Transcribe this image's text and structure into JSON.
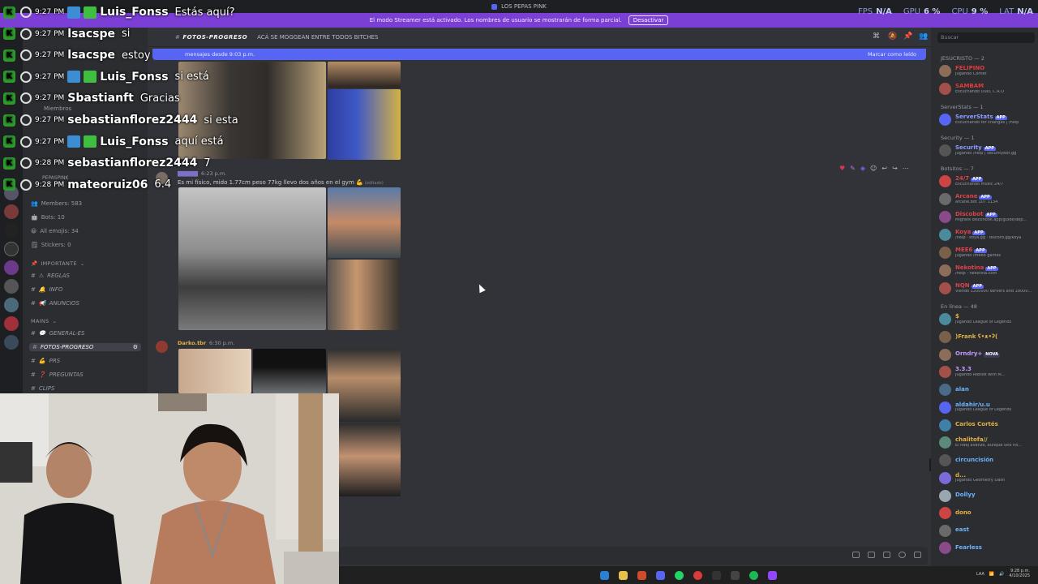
{
  "window": {
    "title": "LOS PEPAS PINK"
  },
  "perf": [
    {
      "label": "FPS",
      "value": "N/A"
    },
    {
      "label": "GPU",
      "value": "6 %"
    },
    {
      "label": "CPU",
      "value": "9 %"
    },
    {
      "label": "LAT",
      "value": "N/A"
    }
  ],
  "streamer_banner": {
    "text": "El modo Streamer está activado. Los nombres de usuario se mostrarán de forma parcial.",
    "button": "Desactivar"
  },
  "sidebar": {
    "members_label": "Miembros",
    "server_name": "PEPASPINK",
    "stats": [
      {
        "icon": "people-icon",
        "text": "Members: 583"
      },
      {
        "icon": "robot-icon",
        "text": "Bots: 10"
      },
      {
        "icon": "emoji-icon",
        "text": "All emojis: 34"
      },
      {
        "icon": "sticker-icon",
        "text": "Stickers: 0"
      }
    ],
    "categories": [
      {
        "name": "IMPORTANTE",
        "channels": [
          "REGLAS",
          "INFO",
          "ANUNCIOS"
        ]
      },
      {
        "name": "MAINS",
        "channels": [
          "GENERAL-ES",
          "FOTOS-PROGRESO",
          "PRS",
          "PREGUNTAS",
          "CLIPS"
        ]
      }
    ],
    "active_channel": "FOTOS-PROGRESO"
  },
  "channel_header": {
    "name": "FOTOS-PROGRESO",
    "topic": "ACÁ SE MOGGEAN ENTRE TODOS BITCHES"
  },
  "new_messages_bar": {
    "left": "mensajes desde 9:03 p.m.",
    "right": "Marcar como leído"
  },
  "messages": [
    {
      "time": "6:23 p.m.",
      "text": "Es mi físico, mido 1.77cm peso 77kg llevo dos años en el gym",
      "edited": "(editado)"
    },
    {
      "author": "Darko.tbr",
      "time": "6:30 p.m."
    }
  ],
  "members_panel": {
    "search_placeholder": "Buscar",
    "groups": [
      {
        "title": "JESUCRISTO — 2",
        "members": [
          {
            "name": "FELIPINO",
            "status": "Jugando Cornet",
            "color": "#e03b3b"
          },
          {
            "name": "SAMBAM",
            "status": "Escuchando Duki, C.R.O",
            "color": "#e03b3b"
          }
        ]
      },
      {
        "title": "ServerStats — 1",
        "members": [
          {
            "name": "ServerStats",
            "app": "APP",
            "status": "Escuchando for changes | /help",
            "color": "#8a9bff"
          }
        ]
      },
      {
        "title": "Security — 1",
        "members": [
          {
            "name": "Security",
            "app": "APP",
            "status": "Jugando /help | securitybot.gg",
            "color": "#8a9bff"
          }
        ]
      },
      {
        "title": "Botsitos — 7",
        "members": [
          {
            "name": "24/7",
            "app": "APP",
            "status": "Escuchando music 24/7",
            "color": "#d9434a"
          },
          {
            "name": "Arcane",
            "app": "APP",
            "status": "arcane.bot 107 1134",
            "color": "#d9434a"
          },
          {
            "name": "Discobot",
            "app": "APP",
            "status": "Migrate discohook.app/guide/dep...",
            "color": "#d9434a"
          },
          {
            "name": "Koya",
            "app": "APP",
            "status": "/help · koya.gg · discord.gg/koya",
            "color": "#d9434a"
          },
          {
            "name": "MEE6",
            "app": "APP",
            "status": "Jugando /mee6 games",
            "color": "#d9434a"
          },
          {
            "name": "Nekotina",
            "app": "APP",
            "status": "/help - nekotina.com",
            "color": "#d9434a"
          },
          {
            "name": "NQN",
            "app": "APP",
            "status": "Viendo 1200000 servers and 18000...",
            "color": "#d9434a"
          }
        ]
      },
      {
        "title": "En línea — 48",
        "members": [
          {
            "name": "$",
            "status": "Jugando League of Legends",
            "color": "#e3b341"
          },
          {
            "name": ")Frank ʕ•ᴥ•ʔ(",
            "status": "",
            "color": "#e3b341"
          },
          {
            "name": "Orndry+",
            "nova": "NOVA",
            "status": "",
            "color": "#c597ff"
          },
          {
            "name": "3.3.3",
            "status": "Jugando Roblox with M...",
            "color": "#c597ff"
          },
          {
            "name": "alan",
            "status": "",
            "color": "#6ab4ff"
          },
          {
            "name": "aldahir/u.u",
            "status": "Jugando League of Legends",
            "color": "#6ab4ff"
          },
          {
            "name": "Carlos Cortés",
            "status": "",
            "color": "#e3b341"
          },
          {
            "name": "chalitofa//",
            "status": "El ndej avanza, aunque uno no...",
            "color": "#e3b341"
          },
          {
            "name": "circuncisión",
            "status": "",
            "color": "#6ab4ff"
          },
          {
            "name": "d...",
            "status": "Jugando Geometry Dash",
            "color": "#e3b341"
          },
          {
            "name": "Dollyy",
            "status": "",
            "color": "#6ab4ff"
          },
          {
            "name": "dono",
            "status": "",
            "color": "#e3b341"
          },
          {
            "name": "east",
            "status": "",
            "color": "#6ab4ff"
          },
          {
            "name": "Fearless",
            "status": "",
            "color": "#6ab4ff"
          }
        ]
      }
    ]
  },
  "chat_overlay": [
    {
      "time": "9:27 PM",
      "user": "Luis_Fonss",
      "msg": "Estás aquí?",
      "badges": true
    },
    {
      "time": "9:27 PM",
      "user": "lsacspe",
      "msg": "si",
      "badges": false
    },
    {
      "time": "9:27 PM",
      "user": "lsacspe",
      "msg": "estoy",
      "badges": false
    },
    {
      "time": "9:27 PM",
      "user": "Luis_Fonss",
      "msg": "si está",
      "badges": true
    },
    {
      "time": "9:27 PM",
      "user": "Sbastianft",
      "msg": "Gracias",
      "badges": false
    },
    {
      "time": "9:27 PM",
      "user": "sebastianflorez2444",
      "msg": "si esta",
      "badges": false
    },
    {
      "time": "9:27 PM",
      "user": "Luis_Fonss",
      "msg": "aquí está",
      "badges": true
    },
    {
      "time": "9:28 PM",
      "user": "sebastianflorez2444",
      "msg": "7",
      "badges": false
    },
    {
      "time": "9:28 PM",
      "user": "mateoruiz06",
      "msg": "6.4",
      "badges": false
    }
  ],
  "taskbar": {
    "clock_time": "9:28 p.m.",
    "clock_date": "4/10/2025",
    "lang": "LAA"
  },
  "colors": {
    "accent": "#5865f2",
    "streamer": "#7b3fd6",
    "bg": "#313338",
    "sidebar": "#2b2d31",
    "online": "#23a55a"
  }
}
